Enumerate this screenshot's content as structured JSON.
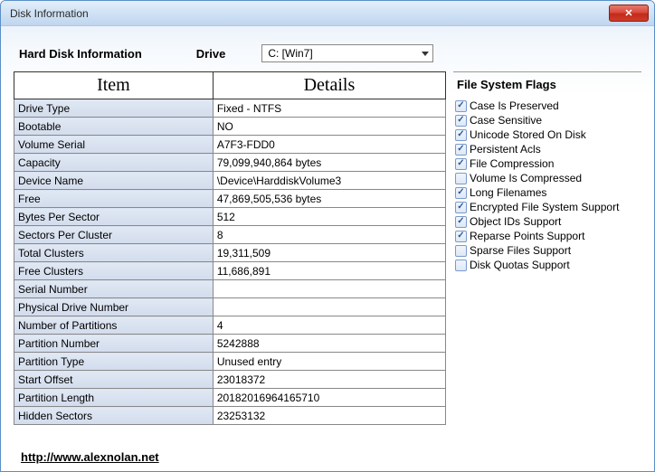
{
  "window": {
    "title": "Disk Information"
  },
  "header": {
    "hd_label": "Hard Disk Information",
    "drive_label": "Drive",
    "drive_selected": "C: [Win7]"
  },
  "table": {
    "col_item": "Item",
    "col_details": "Details",
    "rows": [
      {
        "item": "Drive Type",
        "details": "Fixed - NTFS"
      },
      {
        "item": "Bootable",
        "details": "NO"
      },
      {
        "item": "Volume Serial",
        "details": "A7F3-FDD0"
      },
      {
        "item": "Capacity",
        "details": "79,099,940,864 bytes"
      },
      {
        "item": "Device Name",
        "details": "\\Device\\HarddiskVolume3"
      },
      {
        "item": "Free",
        "details": "47,869,505,536 bytes"
      },
      {
        "item": "Bytes Per Sector",
        "details": "512"
      },
      {
        "item": "Sectors Per Cluster",
        "details": "8"
      },
      {
        "item": "Total Clusters",
        "details": "19,311,509"
      },
      {
        "item": "Free Clusters",
        "details": "11,686,891"
      },
      {
        "item": "Serial Number",
        "details": ""
      },
      {
        "item": "Physical Drive Number",
        "details": ""
      },
      {
        "item": "Number of Partitions",
        "details": "4"
      },
      {
        "item": "Partition Number",
        "details": "5242888"
      },
      {
        "item": "Partition Type",
        "details": "Unused entry"
      },
      {
        "item": "Start Offset",
        "details": "23018372"
      },
      {
        "item": "Partition Length",
        "details": "20182016964165710"
      },
      {
        "item": "Hidden Sectors",
        "details": "23253132"
      }
    ]
  },
  "flags": {
    "title": "File System Flags",
    "items": [
      {
        "label": "Case Is Preserved",
        "checked": true
      },
      {
        "label": "Case Sensitive",
        "checked": true
      },
      {
        "label": "Unicode Stored On Disk",
        "checked": true
      },
      {
        "label": "Persistent Acls",
        "checked": true
      },
      {
        "label": "File Compression",
        "checked": true
      },
      {
        "label": "Volume Is Compressed",
        "checked": false
      },
      {
        "label": "Long Filenames",
        "checked": true
      },
      {
        "label": "Encrypted File System Support",
        "checked": true
      },
      {
        "label": "Object IDs Support",
        "checked": true
      },
      {
        "label": "Reparse Points Support",
        "checked": true
      },
      {
        "label": "Sparse Files Support",
        "checked": false
      },
      {
        "label": "Disk Quotas Support",
        "checked": false
      }
    ]
  },
  "footer": {
    "link_text": "http://www.alexnolan.net"
  }
}
